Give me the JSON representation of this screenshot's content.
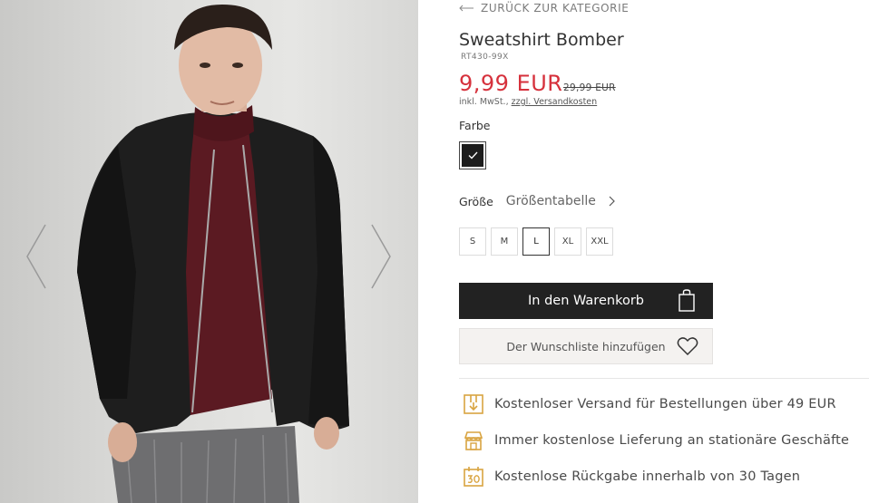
{
  "gallery": {
    "prev_label": "previous-image",
    "next_label": "next-image"
  },
  "nav": {
    "back_label": "ZURÜCK ZUR KATEGORIE"
  },
  "product": {
    "title": "Sweatshirt Bomber",
    "sku": "RT430-99X",
    "price": "9,99 EUR",
    "old_price": "29,99 EUR",
    "tax_prefix": "inkl. MwSt., ",
    "shipping_link": "zzgl. Versandkosten"
  },
  "color": {
    "label": "Farbe",
    "selected_swatch": "#1d1d1d"
  },
  "size": {
    "label": "Größe",
    "chart_link": "Größentabelle",
    "options": [
      "S",
      "M",
      "L",
      "XL",
      "XXL"
    ],
    "selected": "L"
  },
  "actions": {
    "add_to_cart": "In den Warenkorb",
    "add_to_wishlist": "Der Wunschliste hinzufügen"
  },
  "benefits": [
    {
      "icon": "shipping-box-icon",
      "text": "Kostenloser Versand für Bestellungen über 49 EUR"
    },
    {
      "icon": "store-icon",
      "text": "Immer kostenlose Lieferung an stationäre Geschäfte"
    },
    {
      "icon": "calendar-30-icon",
      "text": "Kostenlose Rückgabe innerhalb von 30 Tagen"
    }
  ],
  "colors": {
    "accent_price": "#d6313c",
    "icon_gold": "#d9a441",
    "button_dark": "#222222"
  }
}
